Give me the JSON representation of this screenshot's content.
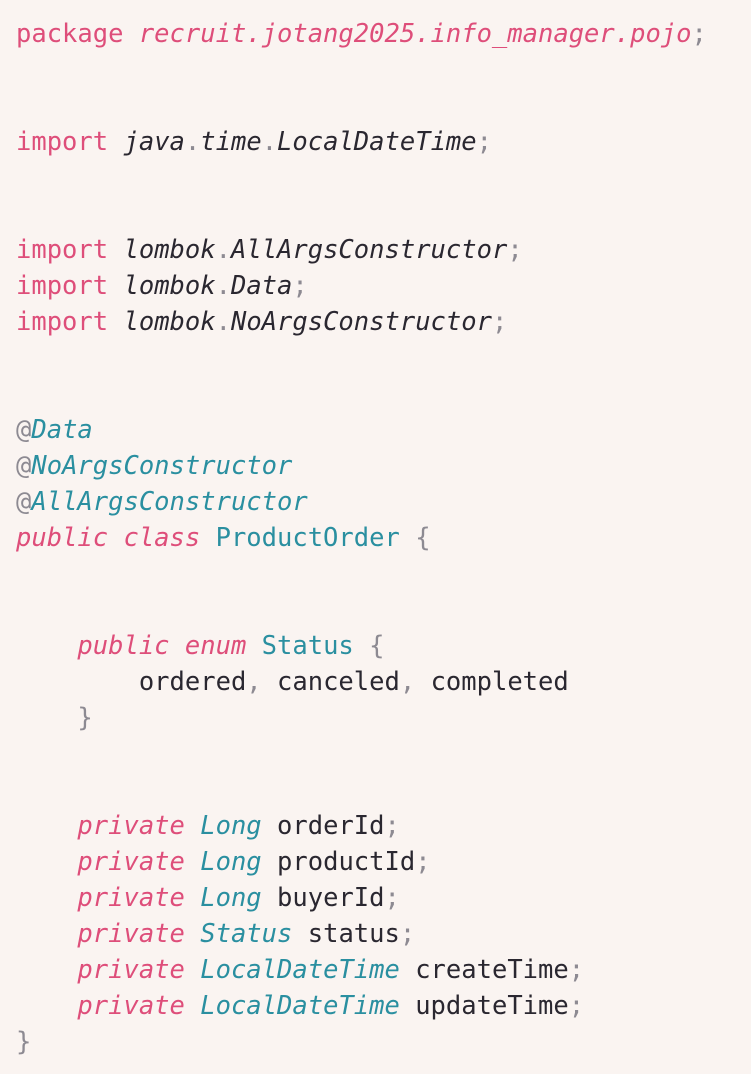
{
  "editor": {
    "lines": [
      {
        "segments": [
          {
            "t": "package",
            "c": "kw"
          },
          {
            "t": " "
          },
          {
            "t": "recruit.jotang2025.info_manager.pojo",
            "c": "pkg"
          },
          {
            "t": ";",
            "c": "pn"
          }
        ]
      },
      {
        "segments": []
      },
      {
        "segments": []
      },
      {
        "segments": [
          {
            "t": "import",
            "c": "kw"
          },
          {
            "t": " "
          },
          {
            "t": "java",
            "c": "idi"
          },
          {
            "t": ".",
            "c": "pn"
          },
          {
            "t": "time",
            "c": "idi"
          },
          {
            "t": ".",
            "c": "pn"
          },
          {
            "t": "LocalDateTime",
            "c": "idi"
          },
          {
            "t": ";",
            "c": "pn"
          }
        ]
      },
      {
        "segments": []
      },
      {
        "segments": []
      },
      {
        "segments": [
          {
            "t": "import",
            "c": "kw"
          },
          {
            "t": " "
          },
          {
            "t": "lombok",
            "c": "idi"
          },
          {
            "t": ".",
            "c": "pn"
          },
          {
            "t": "AllArgsConstructor",
            "c": "idi"
          },
          {
            "t": ";",
            "c": "pn"
          }
        ]
      },
      {
        "segments": [
          {
            "t": "import",
            "c": "kw"
          },
          {
            "t": " "
          },
          {
            "t": "lombok",
            "c": "idi"
          },
          {
            "t": ".",
            "c": "pn"
          },
          {
            "t": "Data",
            "c": "idi"
          },
          {
            "t": ";",
            "c": "pn"
          }
        ]
      },
      {
        "segments": [
          {
            "t": "import",
            "c": "kw"
          },
          {
            "t": " "
          },
          {
            "t": "lombok",
            "c": "idi"
          },
          {
            "t": ".",
            "c": "pn"
          },
          {
            "t": "NoArgsConstructor",
            "c": "idi"
          },
          {
            "t": ";",
            "c": "pn"
          }
        ]
      },
      {
        "segments": []
      },
      {
        "segments": []
      },
      {
        "segments": [
          {
            "t": "@",
            "c": "at"
          },
          {
            "t": "Data",
            "c": "an"
          }
        ]
      },
      {
        "segments": [
          {
            "t": "@",
            "c": "at"
          },
          {
            "t": "NoArgsConstructor",
            "c": "an"
          }
        ]
      },
      {
        "segments": [
          {
            "t": "@",
            "c": "at"
          },
          {
            "t": "AllArgsConstructor",
            "c": "an"
          }
        ]
      },
      {
        "segments": [
          {
            "t": "public class",
            "c": "kw it"
          },
          {
            "t": " "
          },
          {
            "t": "ProductOrder",
            "c": "ty"
          },
          {
            "t": " "
          },
          {
            "t": "{",
            "c": "pn"
          }
        ]
      },
      {
        "segments": []
      },
      {
        "segments": []
      },
      {
        "segments": [
          {
            "t": "    "
          },
          {
            "t": "public enum",
            "c": "kw it"
          },
          {
            "t": " "
          },
          {
            "t": "Status",
            "c": "ty"
          },
          {
            "t": " "
          },
          {
            "t": "{",
            "c": "pn"
          }
        ]
      },
      {
        "segments": [
          {
            "t": "        "
          },
          {
            "t": "ordered",
            "c": "id"
          },
          {
            "t": ",",
            "c": "pn"
          },
          {
            "t": " "
          },
          {
            "t": "canceled",
            "c": "id"
          },
          {
            "t": ",",
            "c": "pn"
          },
          {
            "t": " "
          },
          {
            "t": "completed",
            "c": "id"
          }
        ]
      },
      {
        "segments": [
          {
            "t": "    "
          },
          {
            "t": "}",
            "c": "pn"
          }
        ]
      },
      {
        "segments": []
      },
      {
        "segments": []
      },
      {
        "segments": [
          {
            "t": "    "
          },
          {
            "t": "private",
            "c": "kw it"
          },
          {
            "t": " "
          },
          {
            "t": "Long",
            "c": "an"
          },
          {
            "t": " "
          },
          {
            "t": "orderId",
            "c": "id"
          },
          {
            "t": ";",
            "c": "pn"
          }
        ]
      },
      {
        "segments": [
          {
            "t": "    "
          },
          {
            "t": "private",
            "c": "kw it"
          },
          {
            "t": " "
          },
          {
            "t": "Long",
            "c": "an"
          },
          {
            "t": " "
          },
          {
            "t": "productId",
            "c": "id"
          },
          {
            "t": ";",
            "c": "pn"
          }
        ]
      },
      {
        "segments": [
          {
            "t": "    "
          },
          {
            "t": "private",
            "c": "kw it"
          },
          {
            "t": " "
          },
          {
            "t": "Long",
            "c": "an"
          },
          {
            "t": " "
          },
          {
            "t": "buyerId",
            "c": "id"
          },
          {
            "t": ";",
            "c": "pn"
          }
        ]
      },
      {
        "segments": [
          {
            "t": "    "
          },
          {
            "t": "private",
            "c": "kw it"
          },
          {
            "t": " "
          },
          {
            "t": "Status",
            "c": "an"
          },
          {
            "t": " "
          },
          {
            "t": "status",
            "c": "id"
          },
          {
            "t": ";",
            "c": "pn"
          }
        ]
      },
      {
        "segments": [
          {
            "t": "    "
          },
          {
            "t": "private",
            "c": "kw it"
          },
          {
            "t": " "
          },
          {
            "t": "LocalDateTime",
            "c": "an"
          },
          {
            "t": " "
          },
          {
            "t": "createTime",
            "c": "id"
          },
          {
            "t": ";",
            "c": "pn"
          }
        ]
      },
      {
        "segments": [
          {
            "t": "    "
          },
          {
            "t": "private",
            "c": "kw it"
          },
          {
            "t": " "
          },
          {
            "t": "LocalDateTime",
            "c": "an"
          },
          {
            "t": " "
          },
          {
            "t": "updateTime",
            "c": "id"
          },
          {
            "t": ";",
            "c": "pn"
          }
        ]
      },
      {
        "segments": [
          {
            "t": "}",
            "c": "pn"
          }
        ]
      }
    ]
  },
  "theme": {
    "background": "#faf4f1",
    "keyword": "#de4e7a",
    "type": "#2a8fa0",
    "punctuation": "#8d8a92",
    "text": "#2a2730"
  }
}
